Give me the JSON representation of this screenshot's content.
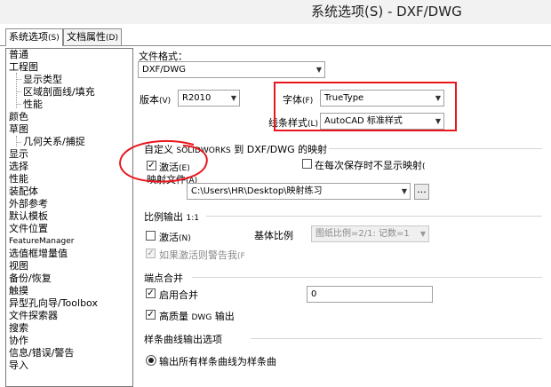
{
  "window": {
    "title": "系统选项(S) - DXF/DWG"
  },
  "tabs": [
    {
      "label": "系统选项",
      "suffix": "(S)"
    },
    {
      "label": "文档属性",
      "suffix": "(D)"
    }
  ],
  "tree": {
    "items": [
      "普通",
      "工程图",
      "显示类型",
      "区域剖面线/填充",
      "性能",
      "颜色",
      "草图",
      "几何关系/捕捉",
      "显示",
      "选择",
      "性能",
      "装配体",
      "外部参考",
      "默认模板",
      "文件位置",
      "FeatureManager",
      "选值框增量值",
      "视图",
      "备份/恢复",
      "触摸",
      "异型孔向导/Toolbox",
      "文件探索器",
      "搜索",
      "协作",
      "信息/错误/警告",
      "导入"
    ]
  },
  "file_format": {
    "label": "文件格式：",
    "value": "DXF/DWG"
  },
  "version": {
    "label": "版本",
    "accel": "(V)",
    "value": "R2010"
  },
  "font": {
    "label": "字体",
    "accel": "(F)",
    "value": "TrueType"
  },
  "line_style": {
    "label": "线条样式",
    "accel": "(L)",
    "value": "AutoCAD 标准样式"
  },
  "mapping": {
    "title_prefix": "自定义",
    "title_brand": "SOLIDWORKS",
    "title_rest": "到 DXF/DWG 的映射",
    "activate_label": "激活",
    "activate_accel": "(E)",
    "activate_checked": true,
    "no_show_label": "在每次保存时不显示映射",
    "no_show_accel": "(",
    "no_show_checked": false,
    "map_file_label": "映射文件",
    "map_file_accel": "(A)",
    "map_file_value": "C:\\Users\\HR\\Desktop\\映射练习",
    "browse_label": "..."
  },
  "scale_output": {
    "title": "比例输出",
    "title_ratio": "1:1",
    "activate_label": "激活",
    "activate_accel": "(N)",
    "activate_checked": false,
    "base_scale_label": "基体比例",
    "base_scale_value": "图纸比例=2/1: 记数=1",
    "warn_label": "如果激活则警告我",
    "warn_accel": "(F",
    "warn_checked": true
  },
  "endpoint_merge": {
    "title": "端点合并",
    "enable_label": "启用合并",
    "enable_checked": true,
    "value": "0",
    "hq_label_prefix": "高质量",
    "hq_label_brand": "DWG",
    "hq_label_rest": "输出",
    "hq_checked": true
  },
  "spline_output": {
    "title": "样条曲线输出选项",
    "option_all_label": "输出所有样条曲线为样条曲",
    "option_all_selected": true
  },
  "colors": {
    "annotation_red": "#e8161d",
    "title_bar": "#f2f2f2"
  }
}
